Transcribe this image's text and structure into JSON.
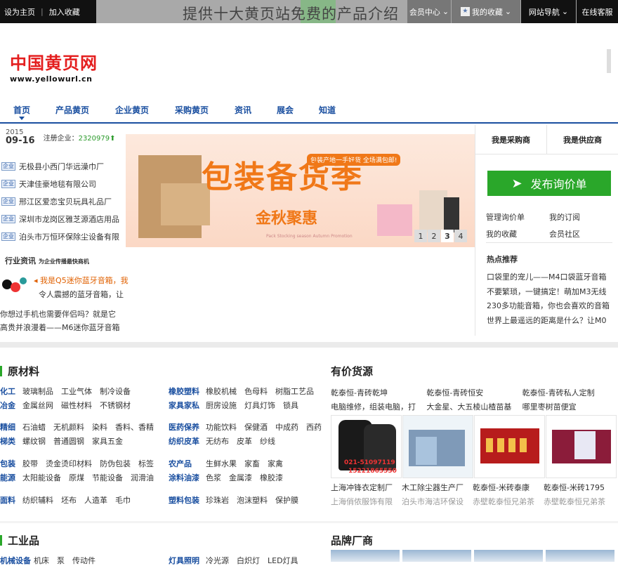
{
  "topbar": {
    "set_home": "设为主页",
    "bookmark": "加入收藏",
    "overlay_title": "提供十大黄页站免费的产品介绍",
    "hidden_menu": "会员中心",
    "my_favorites": "我的收藏",
    "site_nav": "网站导航",
    "online_service": "在线客服"
  },
  "logo": {
    "cn": "中国黄页网",
    "en": "www.yellowurl.cn"
  },
  "nav": [
    "首页",
    "产品黄页",
    "企业黄页",
    "采购黄页",
    "资讯",
    "展会",
    "知道"
  ],
  "date": {
    "year": "2015",
    "md": "09-16",
    "reg_label": "注册企业：",
    "reg_count": "2320979"
  },
  "company_tag": "企业",
  "companies": [
    "无极县小西门华远澡巾厂",
    "天津佳豪地毯有限公司",
    "邢江区爱恋宝贝玩具礼品厂",
    "深圳市龙岗区雅芝源酒店用品",
    "泊头市万恒环保除尘设备有限"
  ],
  "banner": {
    "title": "包装备货季",
    "subtitle": "金秋聚惠",
    "top": "包装产地一手好货 全场满包邮!",
    "eng": "Pack Stocking season Autumn Promotion",
    "pages": [
      "1",
      "2",
      "3",
      "4"
    ],
    "active_page": "3"
  },
  "right": {
    "tab_buyer": "我是采购商",
    "tab_supplier": "我是供应商",
    "rfq": "发布询价单",
    "links": [
      "管理询价单",
      "我的订阅",
      "我的收藏",
      "会员社区"
    ],
    "hot_title": "热点推荐",
    "hot": [
      "口袋里的宠儿——M4口袋蓝牙音箱",
      "不要繁琐，一键搞定！萌加M3无线",
      "230多功能音箱，你也会喜欢的音箱",
      "世界上最遥远的距离是什么？让M0"
    ]
  },
  "news": {
    "title": "行业资讯",
    "title_small": "为企业传播最快商机",
    "t1": "我是Q5迷你蓝牙音箱，我",
    "t2": "令人震撼的蓝牙音箱，让",
    "t3": "你想过手机也需要伴侣吗？就是它",
    "t4": "高贵并浪漫着——M6迷你蓝牙音箱"
  },
  "raw": {
    "title": "原材料",
    "groups": [
      {
        "k": "化工",
        "v": [
          "玻璃制品",
          "工业气体",
          "制冷设备"
        ]
      },
      {
        "k": "冶金",
        "v": [
          "金属丝网",
          "磁性材料",
          "不锈钢材"
        ]
      },
      {
        "k": "精细",
        "v": [
          "石油蜡",
          "无机颜料",
          "染料",
          "香料、香精"
        ]
      },
      {
        "k": "梯类",
        "v": [
          "螺纹钢",
          "普通圆钢",
          "家具五金"
        ]
      },
      {
        "k": "包装",
        "v": [
          "胶带",
          "烫金烫印材料",
          "防伪包装",
          "标签"
        ]
      },
      {
        "k": "能源",
        "v": [
          "太阳能设备",
          "原煤",
          "节能设备",
          "润滑油"
        ]
      },
      {
        "k": "面料",
        "v": [
          "纺织辅料",
          "坯布",
          "人造革",
          "毛巾"
        ]
      }
    ],
    "groups_r": [
      {
        "k": "橡胶塑料",
        "v": [
          "橡胶机械",
          "色母料",
          "树脂工艺品"
        ]
      },
      {
        "k": "家具家私",
        "v": [
          "厨房设施",
          "灯具灯饰",
          "锁具"
        ]
      },
      {
        "k": "医药保养",
        "v": [
          "功能饮料",
          "保健酒",
          "中成药",
          "西药"
        ]
      },
      {
        "k": "纺织皮革",
        "v": [
          "无纺布",
          "皮革",
          "纱线"
        ]
      },
      {
        "k": "农产品",
        "v": [
          "生鲜水果",
          "家畜",
          "家禽"
        ]
      },
      {
        "k": "涂料油漆",
        "v": [
          "色浆",
          "金属漆",
          "橡胶漆"
        ]
      },
      {
        "k": "塑料包装",
        "v": [
          "珍珠岩",
          "泡沫塑料",
          "保护膜"
        ]
      }
    ]
  },
  "prices": {
    "title": "有价货源",
    "row1": [
      "乾泰恒-青砖乾坤",
      "乾泰恒-青砖恒安",
      "乾泰恒-青砖私人定制"
    ],
    "row2": [
      "电脑维修，组装电脑，打",
      "大金星、大五棱山楂苗基",
      "哪里枣树苗便宜"
    ],
    "thumb_phone1": "021-51097119",
    "thumb_phone2": "15221865550",
    "names": [
      "上海冲锋衣定制厂",
      "木工除尘器生产厂",
      "乾泰恒-米砖泰康",
      "乾泰恒-米砖1795"
    ],
    "companies": [
      "上海俏侬服饰有限",
      "泊头市海洁环保设",
      "赤壁乾泰恒兄弟茶",
      "赤壁乾泰恒兄弟茶"
    ]
  },
  "industrial": {
    "title": "工业品",
    "row_k": "机械设备",
    "row_v": [
      "机床",
      "泵",
      "传动件"
    ],
    "row_k2": "灯具照明",
    "row_v2": [
      "冷光源",
      "白炽灯",
      "LED灯具"
    ]
  },
  "brands": {
    "title": "品牌厂商"
  }
}
